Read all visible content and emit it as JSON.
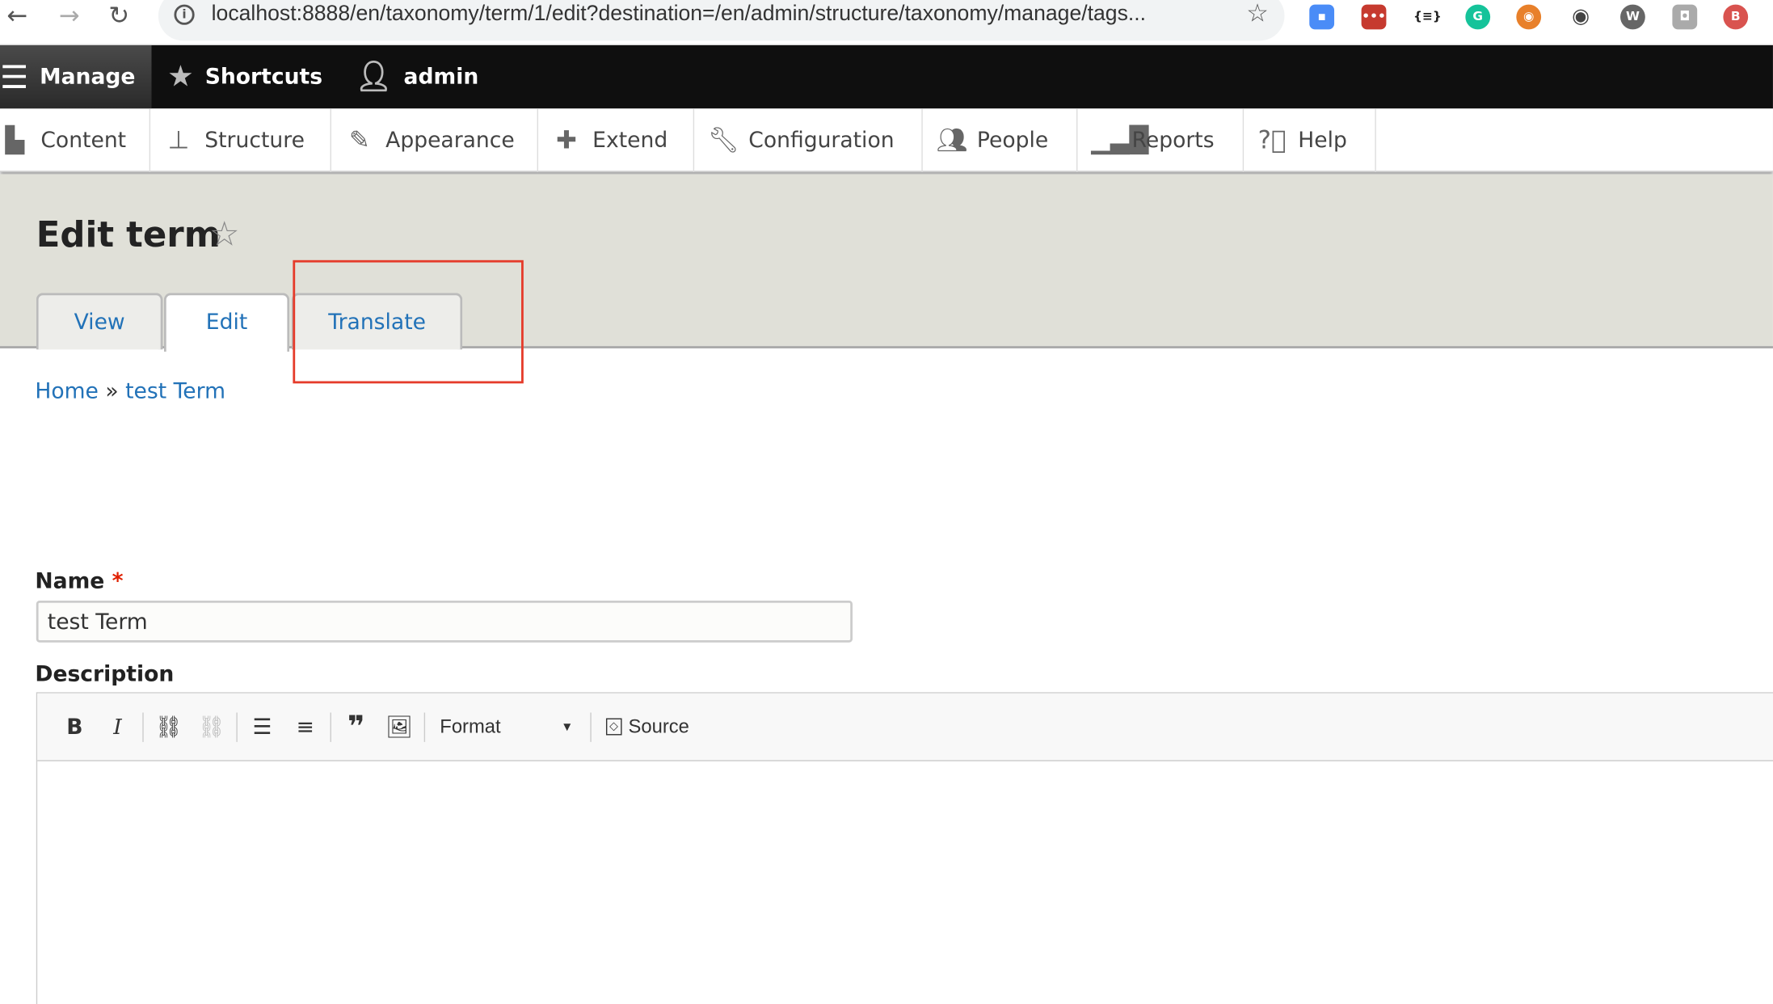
{
  "browser": {
    "url": "localhost:8888/en/taxonomy/term/1/edit?destination=/en/admin/structure/taxonomy/manage/tags..."
  },
  "toolbar": {
    "manage": "Manage",
    "shortcuts": "Shortcuts",
    "user": "admin"
  },
  "tray": {
    "items": [
      {
        "label": "Content",
        "icon": "file-icon"
      },
      {
        "label": "Structure",
        "icon": "sitemap-icon"
      },
      {
        "label": "Appearance",
        "icon": "paintbrush-icon"
      },
      {
        "label": "Extend",
        "icon": "puzzle-icon"
      },
      {
        "label": "Configuration",
        "icon": "wrench-icon"
      },
      {
        "label": "People",
        "icon": "people-icon"
      },
      {
        "label": "Reports",
        "icon": "bar-chart-icon"
      },
      {
        "label": "Help",
        "icon": "help-icon"
      }
    ]
  },
  "page": {
    "title": "Edit term",
    "tabs": [
      {
        "label": "View"
      },
      {
        "label": "Edit",
        "active": true
      },
      {
        "label": "Translate"
      }
    ],
    "breadcrumb": {
      "home": "Home",
      "sep": "»",
      "current": "test Term"
    }
  },
  "form": {
    "name_label": "Name",
    "required": "*",
    "name_value": "test Term",
    "description_label": "Description",
    "editor": {
      "format": "Format",
      "source": "Source"
    }
  },
  "colors": {
    "link": "#2272b8",
    "highlight": "#e53b2a",
    "header_bg": "#e0e0d8"
  }
}
